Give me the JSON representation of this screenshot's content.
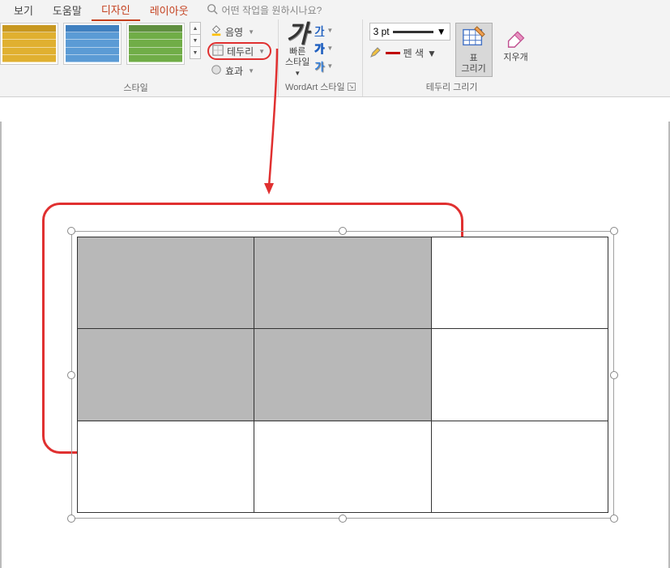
{
  "tabs": {
    "view": "보기",
    "help": "도움말",
    "design": "디자인",
    "layout": "레이아웃"
  },
  "search": {
    "placeholder": "어떤 작업을 원하시나요?"
  },
  "styles_group": {
    "label": "스타일",
    "shading": "음영",
    "border": "테두리",
    "effects": "효과"
  },
  "wordart_group": {
    "label": "WordArt 스타일",
    "quick_label_line1": "빠른",
    "quick_label_line2": "스타일"
  },
  "border_group": {
    "label": "테두리 그리기",
    "weight": "3 pt",
    "pen_color": "펜 색",
    "draw_table_line1": "표",
    "draw_table_line2": "그리기",
    "eraser": "지우개"
  }
}
